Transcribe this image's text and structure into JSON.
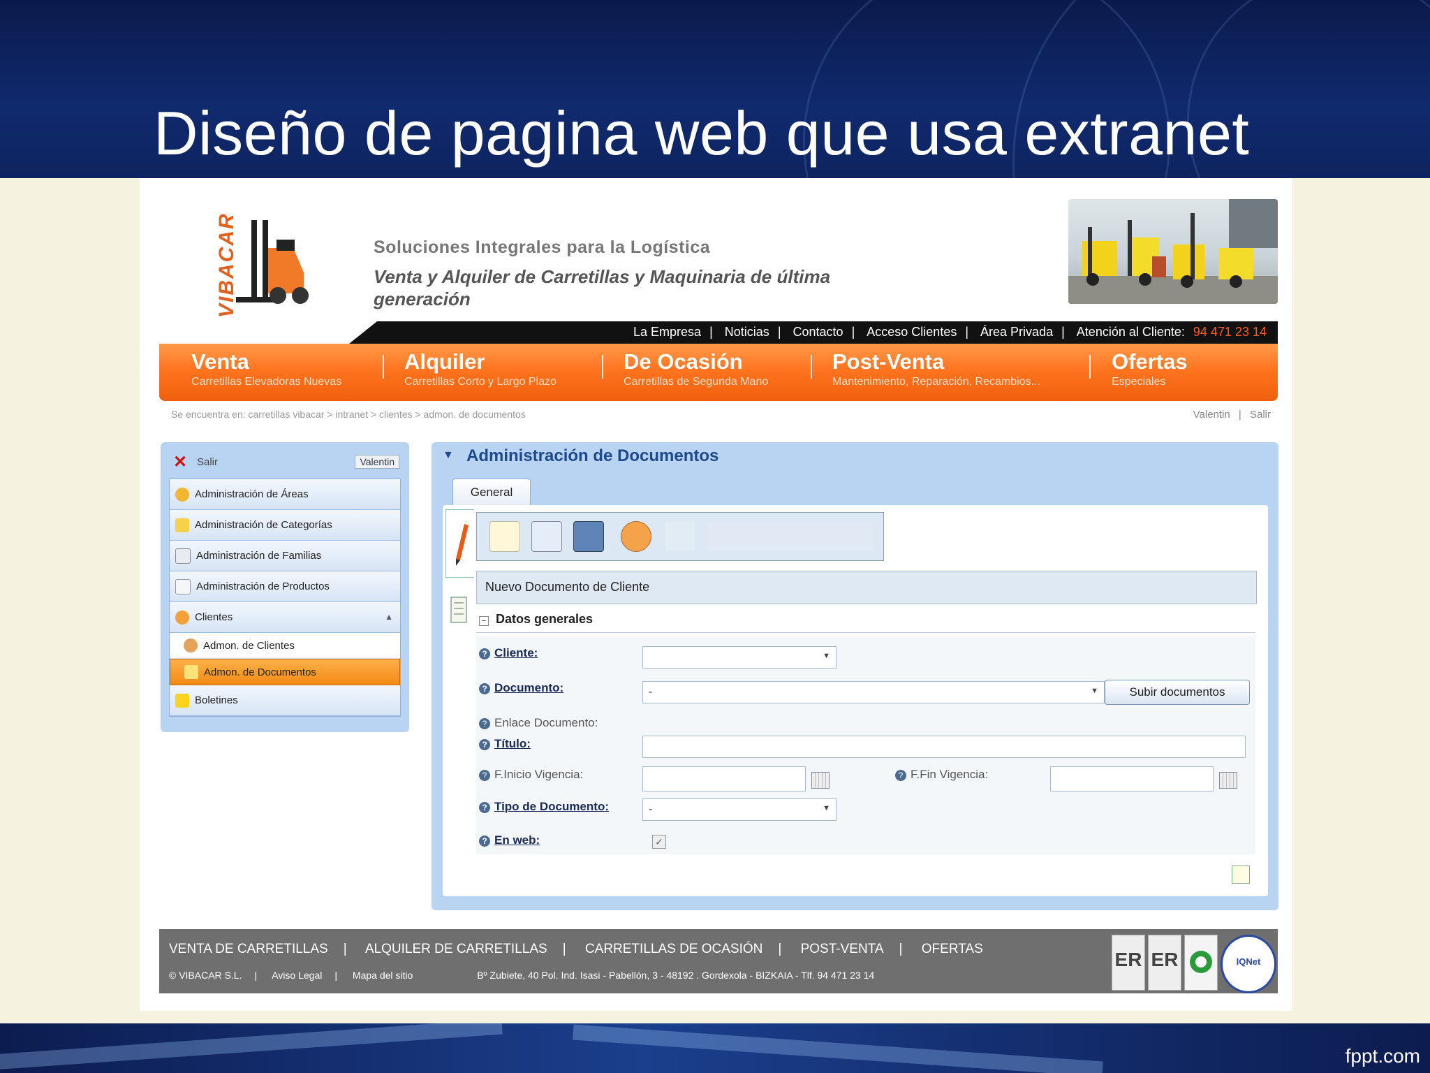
{
  "slide": {
    "title": "Diseño de pagina web que usa extranet",
    "footer_brand": "fppt.com"
  },
  "site": {
    "logo": "VIBACAR",
    "tagline": "Soluciones Integrales para la Logística",
    "subtagline": "Venta y Alquiler de Carretillas y Maquinaria de última generación",
    "topnav": [
      "La Empresa",
      "Noticias",
      "Contacto",
      "Acceso Clientes",
      "Área Privada"
    ],
    "attention_label": "Atención al Cliente:",
    "attention_phone": "94 471 23 14",
    "mainnav": [
      {
        "title": "Venta",
        "sub": "Carretillas Elevadoras Nuevas"
      },
      {
        "title": "Alquiler",
        "sub": "Carretillas Corto y Largo Plazo"
      },
      {
        "title": "De Ocasión",
        "sub": "Carretillas de Segunda Mano"
      },
      {
        "title": "Post-Venta",
        "sub": "Mantenimiento, Reparación, Recambios..."
      },
      {
        "title": "Ofertas",
        "sub": "Especiales"
      }
    ],
    "breadcrumb": "Se encuentra en:  carretillas vibacar > intranet > clientes > admon. de documentos",
    "user_link": "Valentin",
    "logout_link": "Salir"
  },
  "leftmenu": {
    "salir": "Salir",
    "user": "Valentin",
    "items": [
      {
        "label": "Administración de Áreas",
        "icon": "areas-icon"
      },
      {
        "label": "Administración de Categorías",
        "icon": "categories-icon"
      },
      {
        "label": "Administración de Familias",
        "icon": "families-icon"
      },
      {
        "label": "Administración de Productos",
        "icon": "products-icon"
      },
      {
        "label": "Clientes",
        "icon": "clients-icon"
      }
    ],
    "sub_items": [
      {
        "label": "Admon. de Clientes",
        "icon": "client-user-icon"
      },
      {
        "label": "Admon. de Documentos",
        "icon": "documents-folder-icon"
      }
    ],
    "last_item": {
      "label": "Boletines",
      "icon": "newsletter-envelope-icon"
    }
  },
  "panel": {
    "title": "Administración de Documentos",
    "tab": "General",
    "form_title": "Nuevo Documento de Cliente",
    "section": "Datos generales",
    "fields": {
      "cliente": {
        "label": "Cliente:",
        "value": ""
      },
      "documento": {
        "label": "Documento:",
        "value": "-"
      },
      "upload_button": "Subir documentos",
      "enlace": {
        "label": "Enlace Documento:"
      },
      "titulo": {
        "label": "Título:",
        "value": ""
      },
      "finicio": {
        "label": "F.Inicio Vigencia:",
        "value": ""
      },
      "ffin": {
        "label": "F.Fin Vigencia:",
        "value": ""
      },
      "tipo": {
        "label": "Tipo de Documento:",
        "value": "-"
      },
      "enweb": {
        "label": "En web:",
        "checked": true
      }
    }
  },
  "footer": {
    "nav": [
      "VENTA DE CARRETILLAS",
      "ALQUILER DE CARRETILLAS",
      "CARRETILLAS DE OCASIÓN",
      "POST-VENTA",
      "OFERTAS"
    ],
    "copyright": "© VIBACAR S.L.",
    "legal": "Aviso Legal",
    "sitemap": "Mapa del sitio",
    "address": "Bº Zubiete, 40 Pol. Ind. Isasi - Pabellón, 3 - 48192 . Gordexola - BIZKAIA - Tlf. 94 471 23 14",
    "badges": [
      "ER",
      "ER",
      "",
      "IQNet"
    ]
  }
}
